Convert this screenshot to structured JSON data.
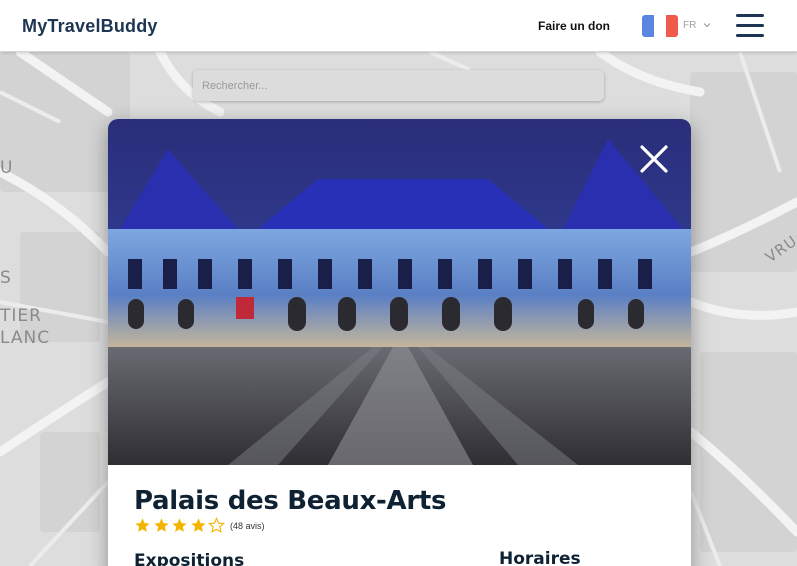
{
  "header": {
    "brand": "MyTravelBuddy",
    "donate_label": "Faire un don",
    "language": "FR",
    "flag_colors": [
      "#5a86e0",
      "#ffffff",
      "#ef5a4c"
    ]
  },
  "search": {
    "placeholder": "Rechercher..."
  },
  "map": {
    "labels": [
      "U",
      "S",
      "TIER",
      "LANC",
      "VRU"
    ]
  },
  "place": {
    "title": "Palais des Beaux-Arts",
    "rating": 4,
    "rating_max": 5,
    "reviews": "(48 avis)",
    "sections": {
      "exhibitions": "Expositions",
      "hours": "Horaires"
    }
  },
  "colors": {
    "brand": "#1d3552",
    "star": "#f5b400"
  },
  "icons": [
    "hamburger-menu-icon",
    "chevron-down-icon",
    "close-icon",
    "star-icon"
  ]
}
